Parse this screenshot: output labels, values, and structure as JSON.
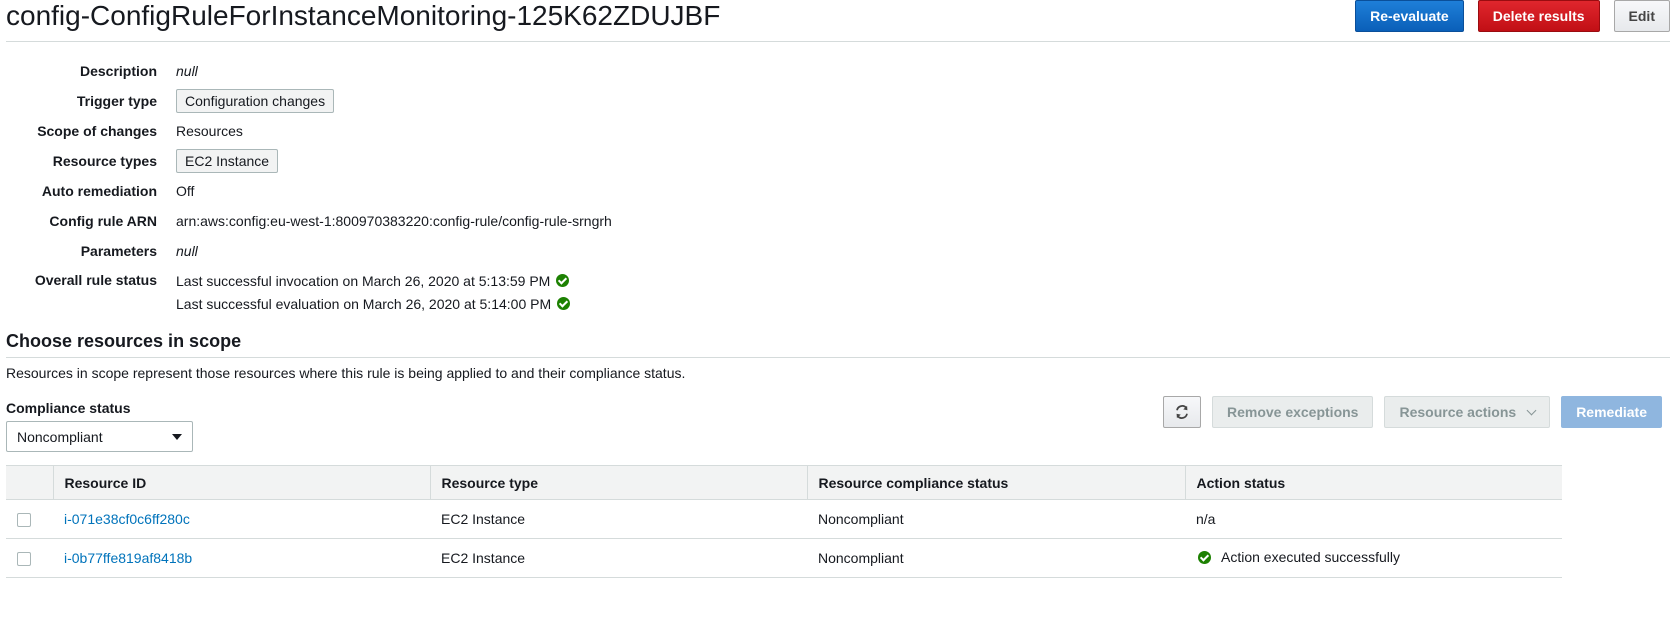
{
  "header": {
    "title": "config-ConfigRuleForInstanceMonitoring-125K62ZDUJBF",
    "reevaluate_label": "Re-evaluate",
    "delete_label": "Delete results",
    "edit_label": "Edit"
  },
  "details": {
    "description_label": "Description",
    "description_value": "null",
    "trigger_label": "Trigger type",
    "trigger_value": "Configuration changes",
    "scope_label": "Scope of changes",
    "scope_value": "Resources",
    "resource_types_label": "Resource types",
    "resource_types_value": "EC2 Instance",
    "auto_remediation_label": "Auto remediation",
    "auto_remediation_value": "Off",
    "arn_label": "Config rule ARN",
    "arn_value": "arn:aws:config:eu-west-1:800970383220:config-rule/config-rule-srngrh",
    "parameters_label": "Parameters",
    "parameters_value": "null",
    "status_label": "Overall rule status",
    "status_invocation": "Last successful invocation on March 26, 2020 at 5:13:59 PM",
    "status_evaluation": "Last successful evaluation on March 26, 2020 at 5:14:00 PM"
  },
  "scope_section": {
    "title": "Choose resources in scope",
    "description": "Resources in scope represent those resources where this rule is being applied to and their compliance status.",
    "filter_label": "Compliance status",
    "filter_value": "Noncompliant",
    "remove_exceptions_label": "Remove exceptions",
    "resource_actions_label": "Resource actions",
    "remediate_label": "Remediate"
  },
  "table": {
    "columns": [
      "Resource ID",
      "Resource type",
      "Resource compliance status",
      "Action status"
    ],
    "rows": [
      {
        "id": "i-071e38cf0c6ff280c",
        "type": "EC2 Instance",
        "compliance": "Noncompliant",
        "action": "n/a"
      },
      {
        "id": "i-0b77ffe819af8418b",
        "type": "EC2 Instance",
        "compliance": "Noncompliant",
        "action": "Action executed successfully"
      }
    ]
  },
  "colors": {
    "primary": "#0a5fb8",
    "danger": "#c10f15",
    "link": "#0073bb",
    "noncompliant": "#d13212",
    "success": "#1d8102"
  },
  "icons": {
    "success": "check-circle-icon",
    "refresh": "refresh-icon",
    "dropdown": "caret-down-icon"
  }
}
